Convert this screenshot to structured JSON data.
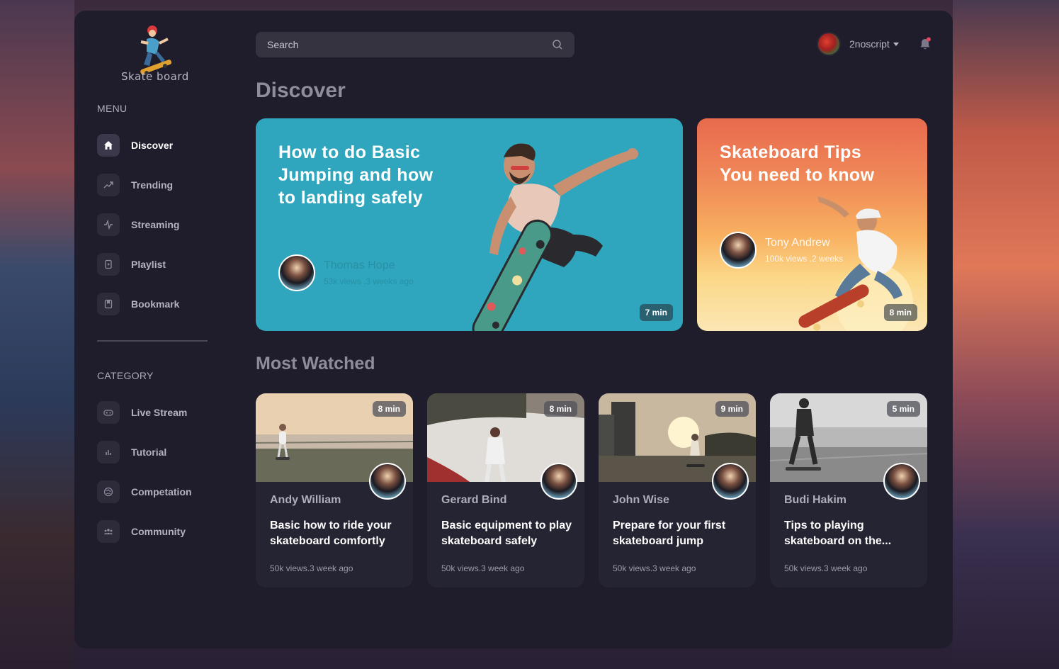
{
  "app": {
    "logo_text": "Skate board"
  },
  "sidebar": {
    "menu_title": "MENU",
    "menu_items": [
      {
        "label": "Discover",
        "icon": "home-icon",
        "active": true
      },
      {
        "label": "Trending",
        "icon": "trending-icon",
        "active": false
      },
      {
        "label": "Streaming",
        "icon": "activity-icon",
        "active": false
      },
      {
        "label": "Playlist",
        "icon": "playlist-icon",
        "active": false
      },
      {
        "label": "Bookmark",
        "icon": "bookmark-icon",
        "active": false
      }
    ],
    "category_title": "CATEGORY",
    "category_items": [
      {
        "label": "Live Stream",
        "icon": "gamepad-icon"
      },
      {
        "label": "Tutorial",
        "icon": "chart-icon"
      },
      {
        "label": "Competation",
        "icon": "globe-icon"
      },
      {
        "label": "Community",
        "icon": "community-icon"
      }
    ]
  },
  "header": {
    "search_placeholder": "Search",
    "username": "2noscript"
  },
  "main": {
    "title": "Discover",
    "featured": [
      {
        "title": "How to do Basic Jumping and how to landing safely",
        "author": "Thomas Hope",
        "meta": "53k views .3 weeks ago",
        "duration": "7 min"
      },
      {
        "title": "Skateboard Tips You need to know",
        "author": "Tony Andrew",
        "meta": "100k views .2 weeks",
        "duration": "8 min"
      }
    ],
    "most_watched_title": "Most Watched",
    "videos": [
      {
        "author": "Andy William",
        "title": "Basic how to ride your skateboard comfortly",
        "meta": "50k views.3 week ago",
        "duration": "8 min"
      },
      {
        "author": "Gerard Bind",
        "title": "Basic equipment to play skateboard safely",
        "meta": "50k views.3 week ago",
        "duration": "8 min"
      },
      {
        "author": "John Wise",
        "title": "Prepare for your first skateboard jump",
        "meta": "50k views.3 week ago",
        "duration": "9 min"
      },
      {
        "author": "Budi Hakim",
        "title": "Tips to playing skateboard on the...",
        "meta": "50k views.3 week ago",
        "duration": "5 min"
      }
    ]
  },
  "colors": {
    "background": "#1f1d2b",
    "card": "#252432",
    "featured_teal": "#2fa6bd",
    "notification_dot": "#e2445c"
  }
}
